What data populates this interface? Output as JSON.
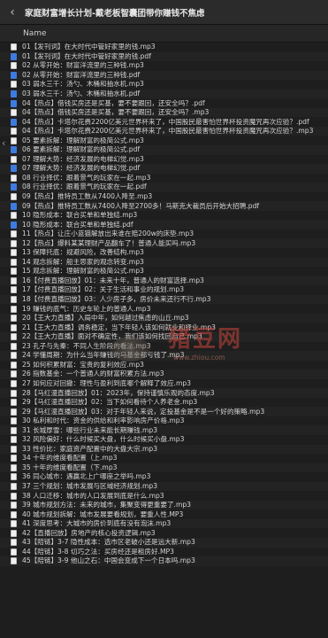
{
  "window": {
    "title": "家庭财富增长计划-戴老板智囊团带你赚钱不焦虑"
  },
  "header": {
    "name_column": "Name"
  },
  "files": [
    {
      "name": "01【发刊词】在大时代中管好家里的钱.mp3",
      "type": "mp3"
    },
    {
      "name": "01【发刊词】在大时代中管好家里的钱.pdf",
      "type": "pdf"
    },
    {
      "name": "02 从零开始：财富洋流里的三种钱.mp3",
      "type": "mp3"
    },
    {
      "name": "02 从零开始：财富洋流里的三种钱.pdf",
      "type": "pdf"
    },
    {
      "name": "03 弱水三千：汤勺、木桶和抽水机.mp3",
      "type": "mp3"
    },
    {
      "name": "03 弱水三千：汤勺、木桶和抽水机.pdf",
      "type": "pdf"
    },
    {
      "name": "04【热点】借钱买房还是买基，要不要跟回，还安全吗？.pdf",
      "type": "pdf"
    },
    {
      "name": "04【热点】借钱买房还是买基，要不要跟回，还安全吗？.mp3",
      "type": "mp3"
    },
    {
      "name": "04【热点】卡塔尔花费2200亿美元世界杯来了，中国股民最害怕世界杯投资魔咒再次应验？.pdf",
      "type": "pdf"
    },
    {
      "name": "04【热点】卡塔尔花费2200亿美元世界杯来了，中国股民最害怕世界杯投资魔咒再次应验？.mp3",
      "type": "mp3"
    },
    {
      "name": "05 要素拆解：理解财富的极简公式.mp3",
      "type": "mp3"
    },
    {
      "name": "06 要素拆解：理解财富的极简公式.pdf",
      "type": "pdf"
    },
    {
      "name": "07 理解大势：经济发展的电梯幻觉.mp3",
      "type": "mp3"
    },
    {
      "name": "07 理解大势：经济发展的电梯幻觉.pdf",
      "type": "pdf"
    },
    {
      "name": "08 行业择优：跟着景气的玩家在一起.mp3",
      "type": "mp3"
    },
    {
      "name": "08 行业择优：跟着景气的玩家在一起.pdf",
      "type": "pdf"
    },
    {
      "name": "09【热点】推特员工数从7400人降至.mp3",
      "type": "mp3"
    },
    {
      "name": "09【热点】推特员工数从7400人降至2700多！马斯克大裁员后开始大招聘.pdf",
      "type": "pdf"
    },
    {
      "name": "10 隐形成本：联合买单和单独结.mp3",
      "type": "mp3"
    },
    {
      "name": "10 隐形成本：联合买单和单独结.pdf",
      "type": "pdf"
    },
    {
      "name": "11【热点】让庄小蓝猫解放出来谁在赔200w的床垫.mp3",
      "type": "mp3"
    },
    {
      "name": "12【热点】爆料某某理财产品翻车了！普通人能买吗.mp3",
      "type": "mp3"
    },
    {
      "name": "13 保障托底：规避风险，改善结构.mp3",
      "type": "mp3"
    },
    {
      "name": "14 观念拆解：船主思家的观念转变.mp3",
      "type": "mp3"
    },
    {
      "name": "15 观念拆解：理解财富的极简公式.mp3",
      "type": "mp3"
    },
    {
      "name": "16【付费直播回放】01：未来十年，普通人的财富选择.mp3",
      "type": "mp3"
    },
    {
      "name": "17【付费直播回放】02：关于生活和事业的规划.mp3",
      "type": "mp3"
    },
    {
      "name": "18【付费直播回放】03：人少房子多，房价未来还行不行.mp3",
      "type": "mp3"
    },
    {
      "name": "19 赚钱的底气：历史车轮上的普通人.mp3",
      "type": "mp3"
    },
    {
      "name": "20【王大力直播】入局中年，如何越过焦虑的山丘.mp3",
      "type": "mp3"
    },
    {
      "name": "21【王大力直播】调务稳定，当下年轻人该如何就业和择业.mp3",
      "type": "mp3"
    },
    {
      "name": "22【王大力直播】面对不确定性，我们该如何找回自己.mp3",
      "type": "mp3"
    },
    {
      "name": "23 孔子与先秦：不同人生阶段的看法.mp3",
      "type": "mp3"
    },
    {
      "name": "24 学懂周期：为什么当年赚钱的马基金都亏钱了.mp3",
      "type": "mp3"
    },
    {
      "name": "25 如何积累财富：宝贵的复利效应.mp3",
      "type": "mp3"
    },
    {
      "name": "26 指数基金：一个普通人的财富积累方法.mp3",
      "type": "mp3"
    },
    {
      "name": "27 如何应对回撤：理性与盈利到底哪个解释了效应.mp3",
      "type": "mp3"
    },
    {
      "name": "28【马红漫直播回放】01：2023年，保持谨慎乐观的态度.mp3",
      "type": "mp3"
    },
    {
      "name": "29【马红漫直播回放】02：当下如何看待个人养老金.mp3",
      "type": "mp3"
    },
    {
      "name": "29【马红漫直播回放】03：对于年轻人来说，定投基金是不是一个好的策略.mp3",
      "type": "mp3"
    },
    {
      "name": "30 私利和时代：资金的供给和利率影响房产价格.mp3",
      "type": "mp3"
    },
    {
      "name": "31 长城厚雪：哪些行业未来能长期赚钱.mp3",
      "type": "mp3"
    },
    {
      "name": "32 风险偏好：什么时候买大盘，什么时候买小盘.mp3",
      "type": "mp3"
    },
    {
      "name": "33 性价比：家庭资产配置中的大盘大宗.mp3",
      "type": "mp3"
    },
    {
      "name": "34 十年的维度看配置（上.mp3",
      "type": "mp3"
    },
    {
      "name": "35 十年的维度看配置（下.mp3",
      "type": "mp3"
    },
    {
      "name": "36 同心城市：遇赢北上广哪座之举吗.mp3",
      "type": "mp3"
    },
    {
      "name": "37 三个规划：城市发展与区域经济规划.mp3",
      "type": "mp3"
    },
    {
      "name": "38 人口迁移：城市的人口发展到底是什么.mp3",
      "type": "mp3"
    },
    {
      "name": "39 城市规划方法：未来的城市，集聚变得更重要了.mp3",
      "type": "mp3"
    },
    {
      "name": "40 城市规划拆解：城市发展要看规划，要重人性.MP3",
      "type": "mp3"
    },
    {
      "name": "41 深度思考：大城市的房价到底有没有泡沫.mp3",
      "type": "mp3"
    },
    {
      "name": "42【直播回放】房地产的核心投资逻辑.mp3",
      "type": "mp3"
    },
    {
      "name": "43【陪链】3-7 隐性成本：选市区老破小还是远大新.mp3",
      "type": "mp3"
    },
    {
      "name": "44【陪链】3-8 切巧之法：买房经还是租房好.MP3",
      "type": "mp3"
    },
    {
      "name": "45【陪链】3-9 他山之石：中国会变成下一个日本吗.mp3",
      "type": "mp3"
    }
  ],
  "watermark": {
    "text": "猪豆网",
    "sub": "www.zhiou.com"
  }
}
